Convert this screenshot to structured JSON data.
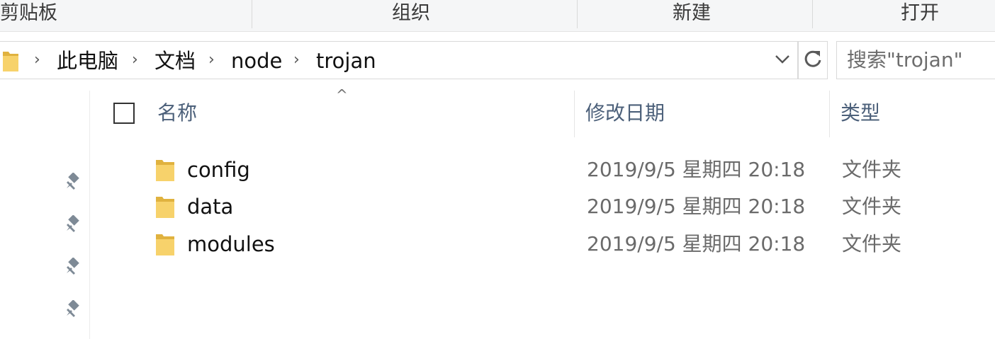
{
  "ribbon": {
    "groups": [
      "剪贴板",
      "组织",
      "新建",
      "打开"
    ]
  },
  "address": {
    "crumbs": [
      "此电脑",
      "文档",
      "node",
      "trojan"
    ]
  },
  "search": {
    "placeholder": "搜索\"trojan\""
  },
  "columns": {
    "name": "名称",
    "date": "修改日期",
    "type": "类型"
  },
  "files": [
    {
      "name": "config",
      "date": "2019/9/5 星期四 20:18",
      "type": "文件夹"
    },
    {
      "name": "data",
      "date": "2019/9/5 星期四 20:18",
      "type": "文件夹"
    },
    {
      "name": "modules",
      "date": "2019/9/5 星期四 20:18",
      "type": "文件夹"
    }
  ],
  "icons": {
    "folder": "folder-icon",
    "pin": "pin-icon",
    "refresh": "refresh-icon",
    "chevron": "chevron-right-icon",
    "dropdown": "chevron-down-icon",
    "sort": "sort-ascending-icon"
  },
  "colors": {
    "folder": "#f7d26b",
    "header_text": "#4c607a",
    "ribbon_bg": "#f5f6f7"
  }
}
